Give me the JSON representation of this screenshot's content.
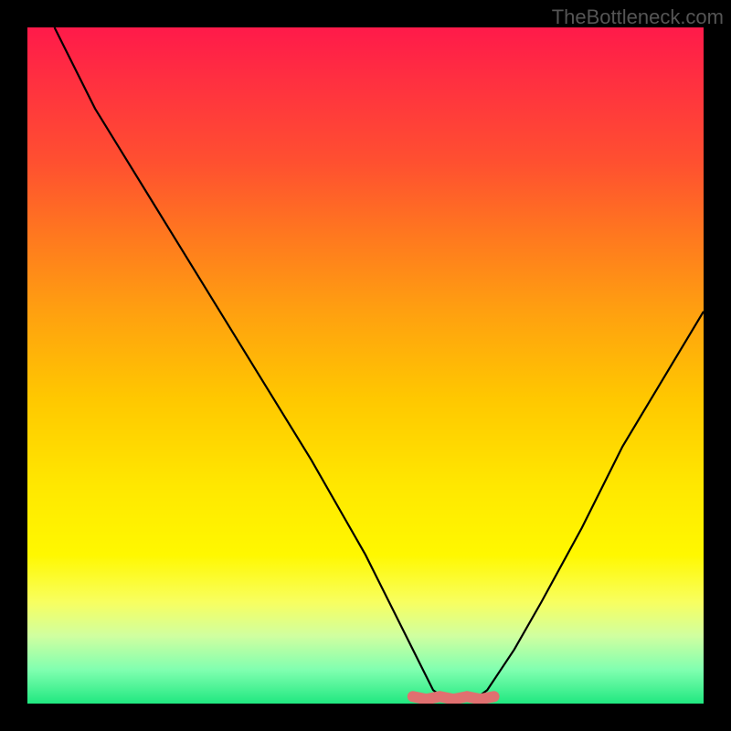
{
  "watermark": "TheBottleneck.com",
  "chart_data": {
    "type": "line",
    "title": "",
    "xlabel": "",
    "ylabel": "",
    "xlim": [
      0,
      100
    ],
    "ylim": [
      0,
      100
    ],
    "grid": false,
    "series": [
      {
        "name": "bottleneck-curve",
        "color": "#000000",
        "x": [
          4,
          10,
          18,
          26,
          34,
          42,
          50,
          54,
          58,
          60,
          62,
          64,
          66,
          68,
          72,
          76,
          82,
          88,
          94,
          100
        ],
        "y": [
          100,
          88,
          75,
          62,
          49,
          36,
          22,
          14,
          6,
          2,
          0.5,
          0.5,
          0.5,
          2,
          8,
          15,
          26,
          38,
          48,
          58
        ]
      }
    ],
    "optimal_marker": {
      "color": "#e07070",
      "x_range": [
        57,
        69
      ],
      "y": 0.5
    },
    "background_gradient": {
      "stops": [
        {
          "pos": 0,
          "color": "#ff1a4a"
        },
        {
          "pos": 8,
          "color": "#ff3040"
        },
        {
          "pos": 20,
          "color": "#ff5030"
        },
        {
          "pos": 30,
          "color": "#ff7520"
        },
        {
          "pos": 42,
          "color": "#ffa010"
        },
        {
          "pos": 55,
          "color": "#ffc800"
        },
        {
          "pos": 68,
          "color": "#ffe800"
        },
        {
          "pos": 78,
          "color": "#fff800"
        },
        {
          "pos": 85,
          "color": "#f8ff60"
        },
        {
          "pos": 90,
          "color": "#d0ffa0"
        },
        {
          "pos": 95,
          "color": "#80ffb0"
        },
        {
          "pos": 100,
          "color": "#20e880"
        }
      ]
    }
  }
}
